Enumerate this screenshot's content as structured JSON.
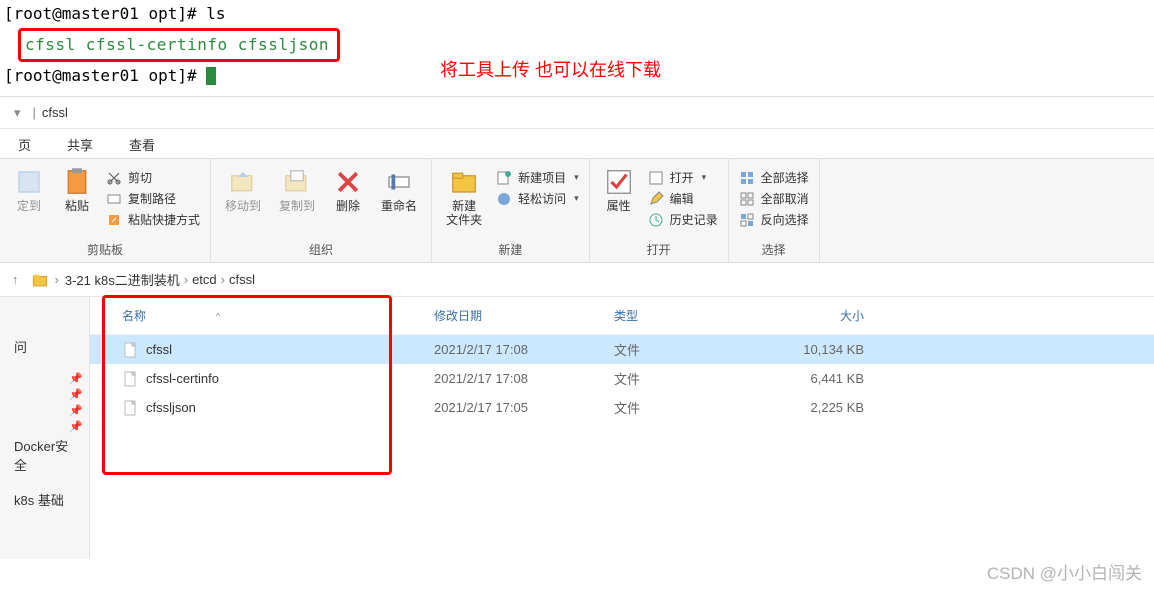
{
  "terminal": {
    "line1_prompt": "[root@master01 opt]# ",
    "line1_cmd": "ls",
    "files": "cfssl  cfssl-certinfo  cfssljson",
    "line3_prompt": "[root@master01 opt]# "
  },
  "annotation": "将工具上传 也可以在线下载",
  "title_bar": {
    "sep": "▾",
    "title": "cfssl"
  },
  "tabs": {
    "tab1": "页",
    "tab2": "共享",
    "tab3": "查看"
  },
  "ribbon": {
    "clipboard": {
      "pin": "定到",
      "paste": "粘贴",
      "cut": "剪切",
      "copy_path": "复制路径",
      "paste_shortcut": "粘贴快捷方式",
      "group": "剪贴板"
    },
    "organize": {
      "move": "移动到",
      "copy": "复制到",
      "delete": "删除",
      "rename": "重命名",
      "group": "组织"
    },
    "new": {
      "newfolder": "新建",
      "newfolder2": "文件夹",
      "newitem": "新建项目",
      "easyaccess": "轻松访问",
      "group": "新建"
    },
    "open": {
      "props": "属性",
      "open": "打开",
      "edit": "编辑",
      "history": "历史记录",
      "group": "打开"
    },
    "select": {
      "selectall": "全部选择",
      "selectnone": "全部取消",
      "invert": "反向选择",
      "group": "选择"
    }
  },
  "breadcrumbs": {
    "b1": "3-21 k8s二进制装机",
    "b2": "etcd",
    "b3": "cfssl"
  },
  "columns": {
    "name": "名称",
    "date": "修改日期",
    "type": "类型",
    "size": "大小"
  },
  "files": [
    {
      "name": "cfssl",
      "date": "2021/2/17 17:08",
      "type": "文件",
      "size": "10,134 KB",
      "selected": true
    },
    {
      "name": "cfssl-certinfo",
      "date": "2021/2/17 17:08",
      "type": "文件",
      "size": "6,441 KB",
      "selected": false
    },
    {
      "name": "cfssljson",
      "date": "2021/2/17 17:05",
      "type": "文件",
      "size": "2,225 KB",
      "selected": false
    }
  ],
  "sidebar": {
    "item1": "问",
    "item2": "Docker安全",
    "item3": "k8s 基础"
  },
  "watermark": "CSDN @小小白闯关"
}
